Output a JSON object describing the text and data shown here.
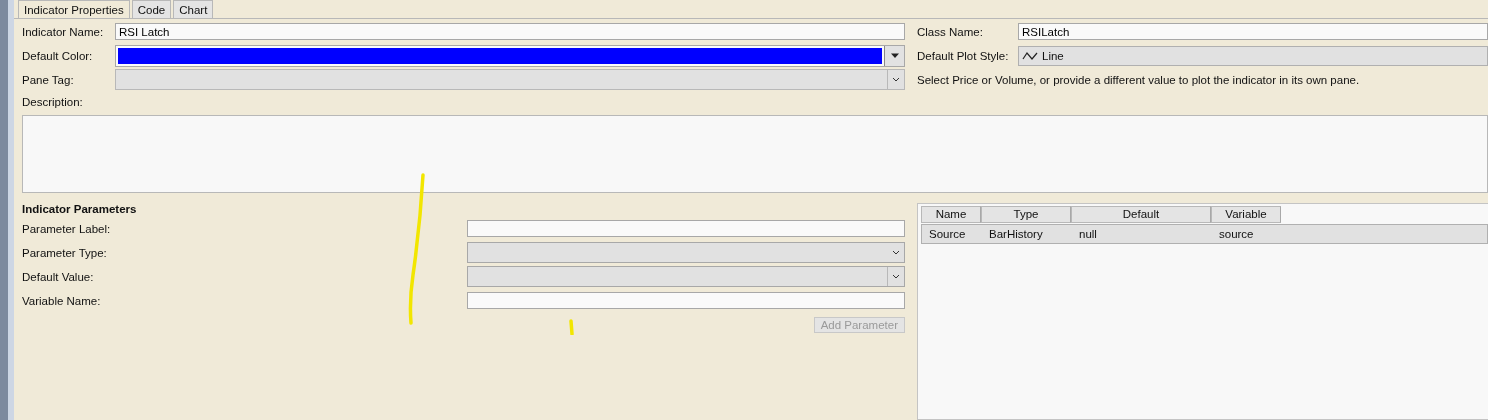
{
  "tabs": [
    {
      "label": "Indicator Properties",
      "selected": true
    },
    {
      "label": "Code",
      "selected": false
    },
    {
      "label": "Chart",
      "selected": false
    }
  ],
  "properties": {
    "indicator_name": {
      "label": "Indicator Name:",
      "value": "RSI Latch"
    },
    "default_color": {
      "label": "Default Color:",
      "color": "#0000ff"
    },
    "pane_tag": {
      "label": "Pane Tag:"
    },
    "class_name": {
      "label": "Class Name:",
      "value": "RSILatch"
    },
    "default_plot_style": {
      "label": "Default Plot Style:",
      "value": "Line"
    },
    "pane_hint": "Select Price or Volume, or provide a different value to plot the indicator in its own pane.",
    "description": {
      "label": "Description:"
    }
  },
  "parameters": {
    "title": "Indicator Parameters",
    "fields": [
      {
        "kind": "text",
        "label": "Parameter Label:"
      },
      {
        "kind": "select",
        "label": "Parameter Type:"
      },
      {
        "kind": "combo",
        "label": "Default Value:"
      },
      {
        "kind": "text",
        "label": "Variable Name:"
      }
    ],
    "add_button": {
      "label": "Add Parameter",
      "disabled": true
    }
  },
  "grid": {
    "columns": [
      "Name",
      "Type",
      "Default",
      "Variable"
    ],
    "rows": [
      {
        "cells": [
          "Source",
          "BarHistory",
          "null",
          "source"
        ],
        "selected": true
      }
    ]
  }
}
